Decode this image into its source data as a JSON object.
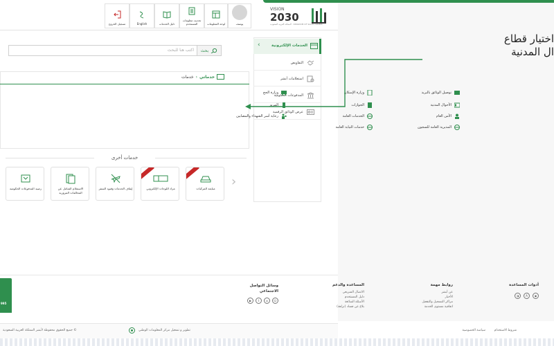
{
  "header": {
    "logo": {
      "vision": "VISION",
      "year": "2030",
      "subtitle": "المملكة العربية السعودية · KINGDOM OF SAUDI ARABIA"
    },
    "toolbar": [
      {
        "id": "user",
        "label": "يوسف",
        "icon": "avatar-icon"
      },
      {
        "id": "info",
        "label": "لوحة المعلومات",
        "icon": "dashboard-icon"
      },
      {
        "id": "update",
        "label": "تحديث معلومات\nالمستخدم",
        "icon": "update-user-icon"
      },
      {
        "id": "guide",
        "label": "دليل الخدمات",
        "icon": "book-icon"
      },
      {
        "id": "lang",
        "label": "English",
        "icon": "language-icon"
      },
      {
        "id": "logout",
        "label": "تسجيل الخروج",
        "icon": "logout-icon"
      }
    ]
  },
  "search": {
    "placeholder": "اكتب هنا للبحث",
    "button_label": "بحث"
  },
  "sidebar": {
    "header_label": "الخدمات الإلكترونية",
    "items": [
      {
        "label": "التفاويض",
        "icon": "handshake-icon"
      },
      {
        "label": "استعلامات أبشر",
        "icon": "document-search-icon"
      },
      {
        "label": "المدفوعات الحكومية",
        "icon": "bank-icon"
      },
      {
        "label": "عرض الوثائق الرقمية",
        "icon": "id-card-icon"
      }
    ]
  },
  "breadcrumb": {
    "current": "خدماتي",
    "separator": "›",
    "parent": "خدمات"
  },
  "services": {
    "col1": [
      {
        "label": "توصيل الوثائق بالبريد",
        "icon": "mail-icon"
      },
      {
        "label": "الأحوال المدنية",
        "icon": "id-icon"
      },
      {
        "label": "الأمن العام",
        "icon": "police-icon"
      },
      {
        "label": "المديرية العامة للسجون",
        "icon": "globe-icon"
      }
    ],
    "col2": [
      {
        "label": "وزارة الإسكان",
        "icon": "building-icon"
      },
      {
        "label": "الجوازات",
        "icon": "passport-icon"
      },
      {
        "label": "الخدمات العامة",
        "icon": "globe-icon"
      },
      {
        "label": "خدمات النيابة العامة",
        "icon": "globe-icon"
      }
    ],
    "col3": [
      {
        "label": "وزارة الحج",
        "icon": "bus-icon"
      },
      {
        "label": "المرور",
        "icon": "traffic-icon"
      },
      {
        "label": "رعاية أسر الشهداء والمصابين",
        "icon": "family-icon"
      }
    ]
  },
  "other_services": {
    "title": "خدمات أخرى",
    "cards": [
      {
        "label": "مبايعة المركبات",
        "icon": "car-icon",
        "badge": true
      },
      {
        "label": "مزاد اللوحات الإلكتروني",
        "icon": "plate-icon",
        "badge": true
      },
      {
        "label": "إيقاف الخدمات وقيود السفر",
        "icon": "no-plane-icon",
        "badge": false
      },
      {
        "label": "الاستعلام الشامل عن المخالفات المرورية",
        "icon": "documents-icon",
        "badge": false
      },
      {
        "label": "رصيد المدفوعات الحكومية",
        "icon": "wallet-icon",
        "badge": false
      }
    ]
  },
  "footer": {
    "tools": {
      "title": "أدوات المساعدة"
    },
    "links": {
      "title": "روابط مهمة",
      "items": [
        "عن أبشر",
        "الأخبار",
        "مراكز التسجيل والتفعيل",
        "اتفاقية مستوى الخدمة"
      ]
    },
    "support": {
      "title": "المساعدة والدعم",
      "items": [
        "الاتصال السريعي",
        "دليل المستخدم",
        "الأسئلة الشائعة",
        "بلاغ عن فساد (نزاهة)"
      ]
    },
    "social": {
      "title": "وسائل التواصل\nالاجتماعي"
    },
    "green_number": "995",
    "bottom": {
      "terms": "شروط الاستخدام",
      "privacy": "سياسة الخصوصية",
      "developer": "تطوير و تشغيل مركز المعلومات الوطني",
      "copyright": "جميع الحقوق محفوظة لأبشر المملكة العربية السعودية ©"
    }
  },
  "callout": {
    "line1": "اختيار قطاع",
    "line2": "ال المدنية"
  },
  "colors": {
    "brand_green": "#2f8f4e",
    "badge_red": "#c62828"
  }
}
